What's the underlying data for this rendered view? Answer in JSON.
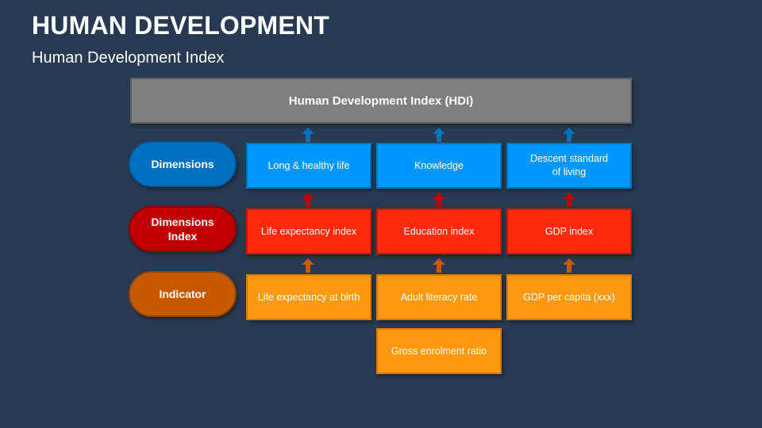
{
  "slide": {
    "title": "HUMAN DEVELOPMENT",
    "subtitle": "Human Development Index"
  },
  "hdi": {
    "label": "Human Development Index (HDI)"
  },
  "row_labels": {
    "dimensions": "Dimensions",
    "dimensions_index_line1": "Dimensions",
    "dimensions_index_line2": "Index",
    "indicator": "Indicator"
  },
  "dimensions": {
    "health": "Long & healthy life",
    "knowledge": "Knowledge",
    "living_line1": "Descent standard",
    "living_line2": "of living"
  },
  "indices": {
    "life_expectancy": "Life expectancy index",
    "education": "Education index",
    "gdp": "GDP index"
  },
  "indicators": {
    "life_expectancy_birth": "Life expectancy at birth",
    "adult_literacy": "Adult literacy rate",
    "gdp_per_capita": "GDP per capita (xxx)",
    "gross_enrolment": "Gross enrolment ratio"
  },
  "colors": {
    "background": "#283a52",
    "hdi": "#7f7f7f",
    "dimensions": "#0098ff",
    "dimensions_label": "#0070c0",
    "index": "#ff2a0a",
    "index_label": "#c00000",
    "indicator": "#ff9a10",
    "indicator_label": "#c55a00",
    "arrow_blue": "#0070c0",
    "arrow_red": "#c00000",
    "arrow_orange": "#c55a00"
  },
  "icons": {
    "connector": "up-arrow-icon"
  }
}
